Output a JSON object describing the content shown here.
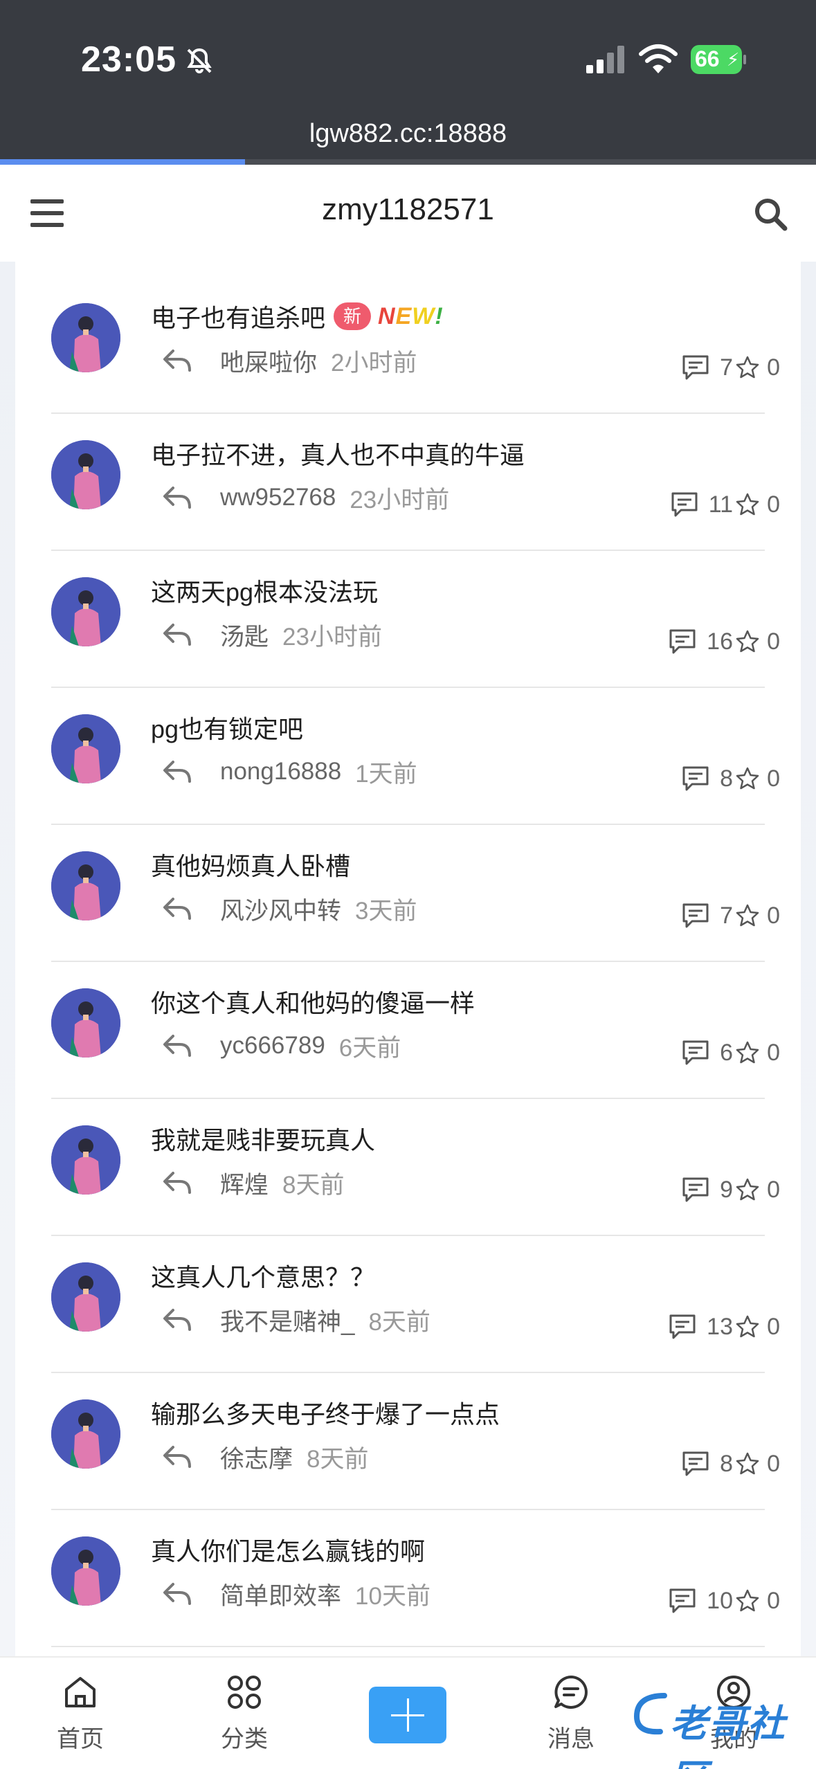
{
  "status_bar": {
    "time": "23:05",
    "battery": "66"
  },
  "browser": {
    "url": "lgw882.cc:18888",
    "load_progress_percent": 30
  },
  "header": {
    "title": "zmy1182571"
  },
  "posts": [
    {
      "title": "电子也有追杀吧",
      "badge": "新",
      "new_art": "NEW!",
      "author": "吔屎啦你",
      "time": "2小时前",
      "comments": "7",
      "stars": "0"
    },
    {
      "title": "电子拉不进，真人也不中真的牛逼",
      "author": "ww952768",
      "time": "23小时前",
      "comments": "11",
      "stars": "0"
    },
    {
      "title": "这两天pg根本没法玩",
      "author": "汤匙",
      "time": "23小时前",
      "comments": "16",
      "stars": "0"
    },
    {
      "title": "pg也有锁定吧",
      "author": "nong16888",
      "time": "1天前",
      "comments": "8",
      "stars": "0"
    },
    {
      "title": "真他妈烦真人卧槽",
      "author": "风沙风中转",
      "time": "3天前",
      "comments": "7",
      "stars": "0"
    },
    {
      "title": "你这个真人和他妈的傻逼一样",
      "author": "yc666789",
      "time": "6天前",
      "comments": "6",
      "stars": "0"
    },
    {
      "title": "我就是贱非要玩真人",
      "author": "辉煌",
      "time": "8天前",
      "comments": "9",
      "stars": "0"
    },
    {
      "title": "这真人几个意思？？",
      "author": "我不是赌神_",
      "time": "8天前",
      "comments": "13",
      "stars": "0"
    },
    {
      "title": "输那么多天电子终于爆了一点点",
      "author": "徐志摩",
      "time": "8天前",
      "comments": "8",
      "stars": "0"
    },
    {
      "title": "真人你们是怎么赢钱的啊",
      "author": "简单即效率",
      "time": "10天前",
      "comments": "10",
      "stars": "0"
    }
  ],
  "bottom_nav": {
    "home": "首页",
    "category": "分类",
    "messages": "消息",
    "mine": "我的"
  },
  "watermark": "老哥社区",
  "colors": {
    "accent": "#39a0f5",
    "badge": "#ef5b6d",
    "avatar_bg": "#4a57b8",
    "status_bar": "#383b41"
  }
}
